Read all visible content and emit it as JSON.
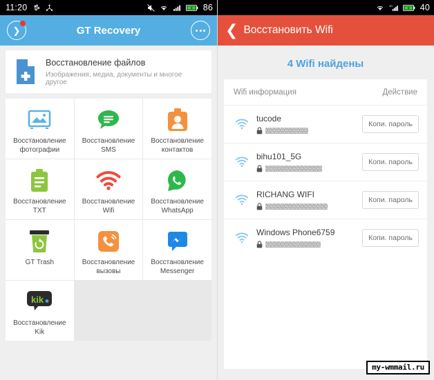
{
  "left": {
    "statusbar": {
      "time": "11:20",
      "icons": [
        "usb-icon",
        "bluetooth-share-icon"
      ],
      "right_icons": [
        "mute-icon",
        "wifi-icon",
        "signal-icon",
        "battery-icon"
      ],
      "battery": "86"
    },
    "appbar": {
      "title": "GT Recovery",
      "back_icon": "chevron-right-circle-icon",
      "menu_icon": "overflow-menu-icon",
      "badge": true,
      "color": "#54aee2"
    },
    "files_card": {
      "icon": "file-plus-icon",
      "title": "Восстановление файлов",
      "subtitle": "Изображения, медиа, документы и многое другое"
    },
    "grid": [
      {
        "label": "Восстановление\nфотографии",
        "icon": "photo-icon",
        "color": "#5bb3e5"
      },
      {
        "label": "Восстановление\nSMS",
        "icon": "sms-bubble-icon",
        "color": "#2eb84c"
      },
      {
        "label": "Восстановление\nконтактов",
        "icon": "contacts-badge-icon",
        "color": "#f5913e"
      },
      {
        "label": "Восстановление TXT",
        "icon": "clipboard-txt-icon",
        "color": "#8cc63e"
      },
      {
        "label": "Восстановление Wifi",
        "icon": "wifi-red-icon",
        "color": "#ee4b3a"
      },
      {
        "label": "Восстановление\nWhatsApp",
        "icon": "whatsapp-icon",
        "color": "#2eb84c"
      },
      {
        "label": "GT Trash",
        "icon": "trash-bin-icon",
        "color": "#8cc63e"
      },
      {
        "label": "Восстановление\nвызовы",
        "icon": "phone-call-icon",
        "color": "#f5913e"
      },
      {
        "label": "Восстановление\nMessenger",
        "icon": "messenger-icon",
        "color": "#1e88e5"
      },
      {
        "label": "Восстановление Kik",
        "icon": "kik-icon",
        "color": "#2b2b2b"
      }
    ]
  },
  "right": {
    "statusbar": {
      "right_icons": [
        "wifi-icon",
        "signal-4g-icon",
        "battery-icon"
      ],
      "battery": "40"
    },
    "appbar": {
      "title": "Восстановить Wifi",
      "back_icon": "chevron-left-icon",
      "color": "#e5503c"
    },
    "found_title": "4 Wifi найдены",
    "table": {
      "col_info": "Wifi информация",
      "col_action": "Действие",
      "rows": [
        {
          "ssid": "tucode",
          "password": "",
          "masked": true,
          "mask_width": 62,
          "action": "Копи. пароль",
          "icon": "wifi-icon",
          "lock": "lock-icon"
        },
        {
          "ssid": "bihu101_5G",
          "password": "",
          "masked": true,
          "mask_width": 82,
          "action": "Копи. пароль",
          "icon": "wifi-icon",
          "lock": "lock-icon"
        },
        {
          "ssid": "RICHANG WIFI",
          "password": "",
          "masked": true,
          "mask_width": 90,
          "action": "Копи. пароль",
          "icon": "wifi-icon",
          "lock": "lock-icon"
        },
        {
          "ssid": "Windows Phone6759",
          "password": "",
          "masked": true,
          "mask_width": 80,
          "action": "Копи. пароль",
          "icon": "wifi-icon",
          "lock": "lock-icon"
        }
      ]
    }
  },
  "watermark": "my-wmmail.ru"
}
